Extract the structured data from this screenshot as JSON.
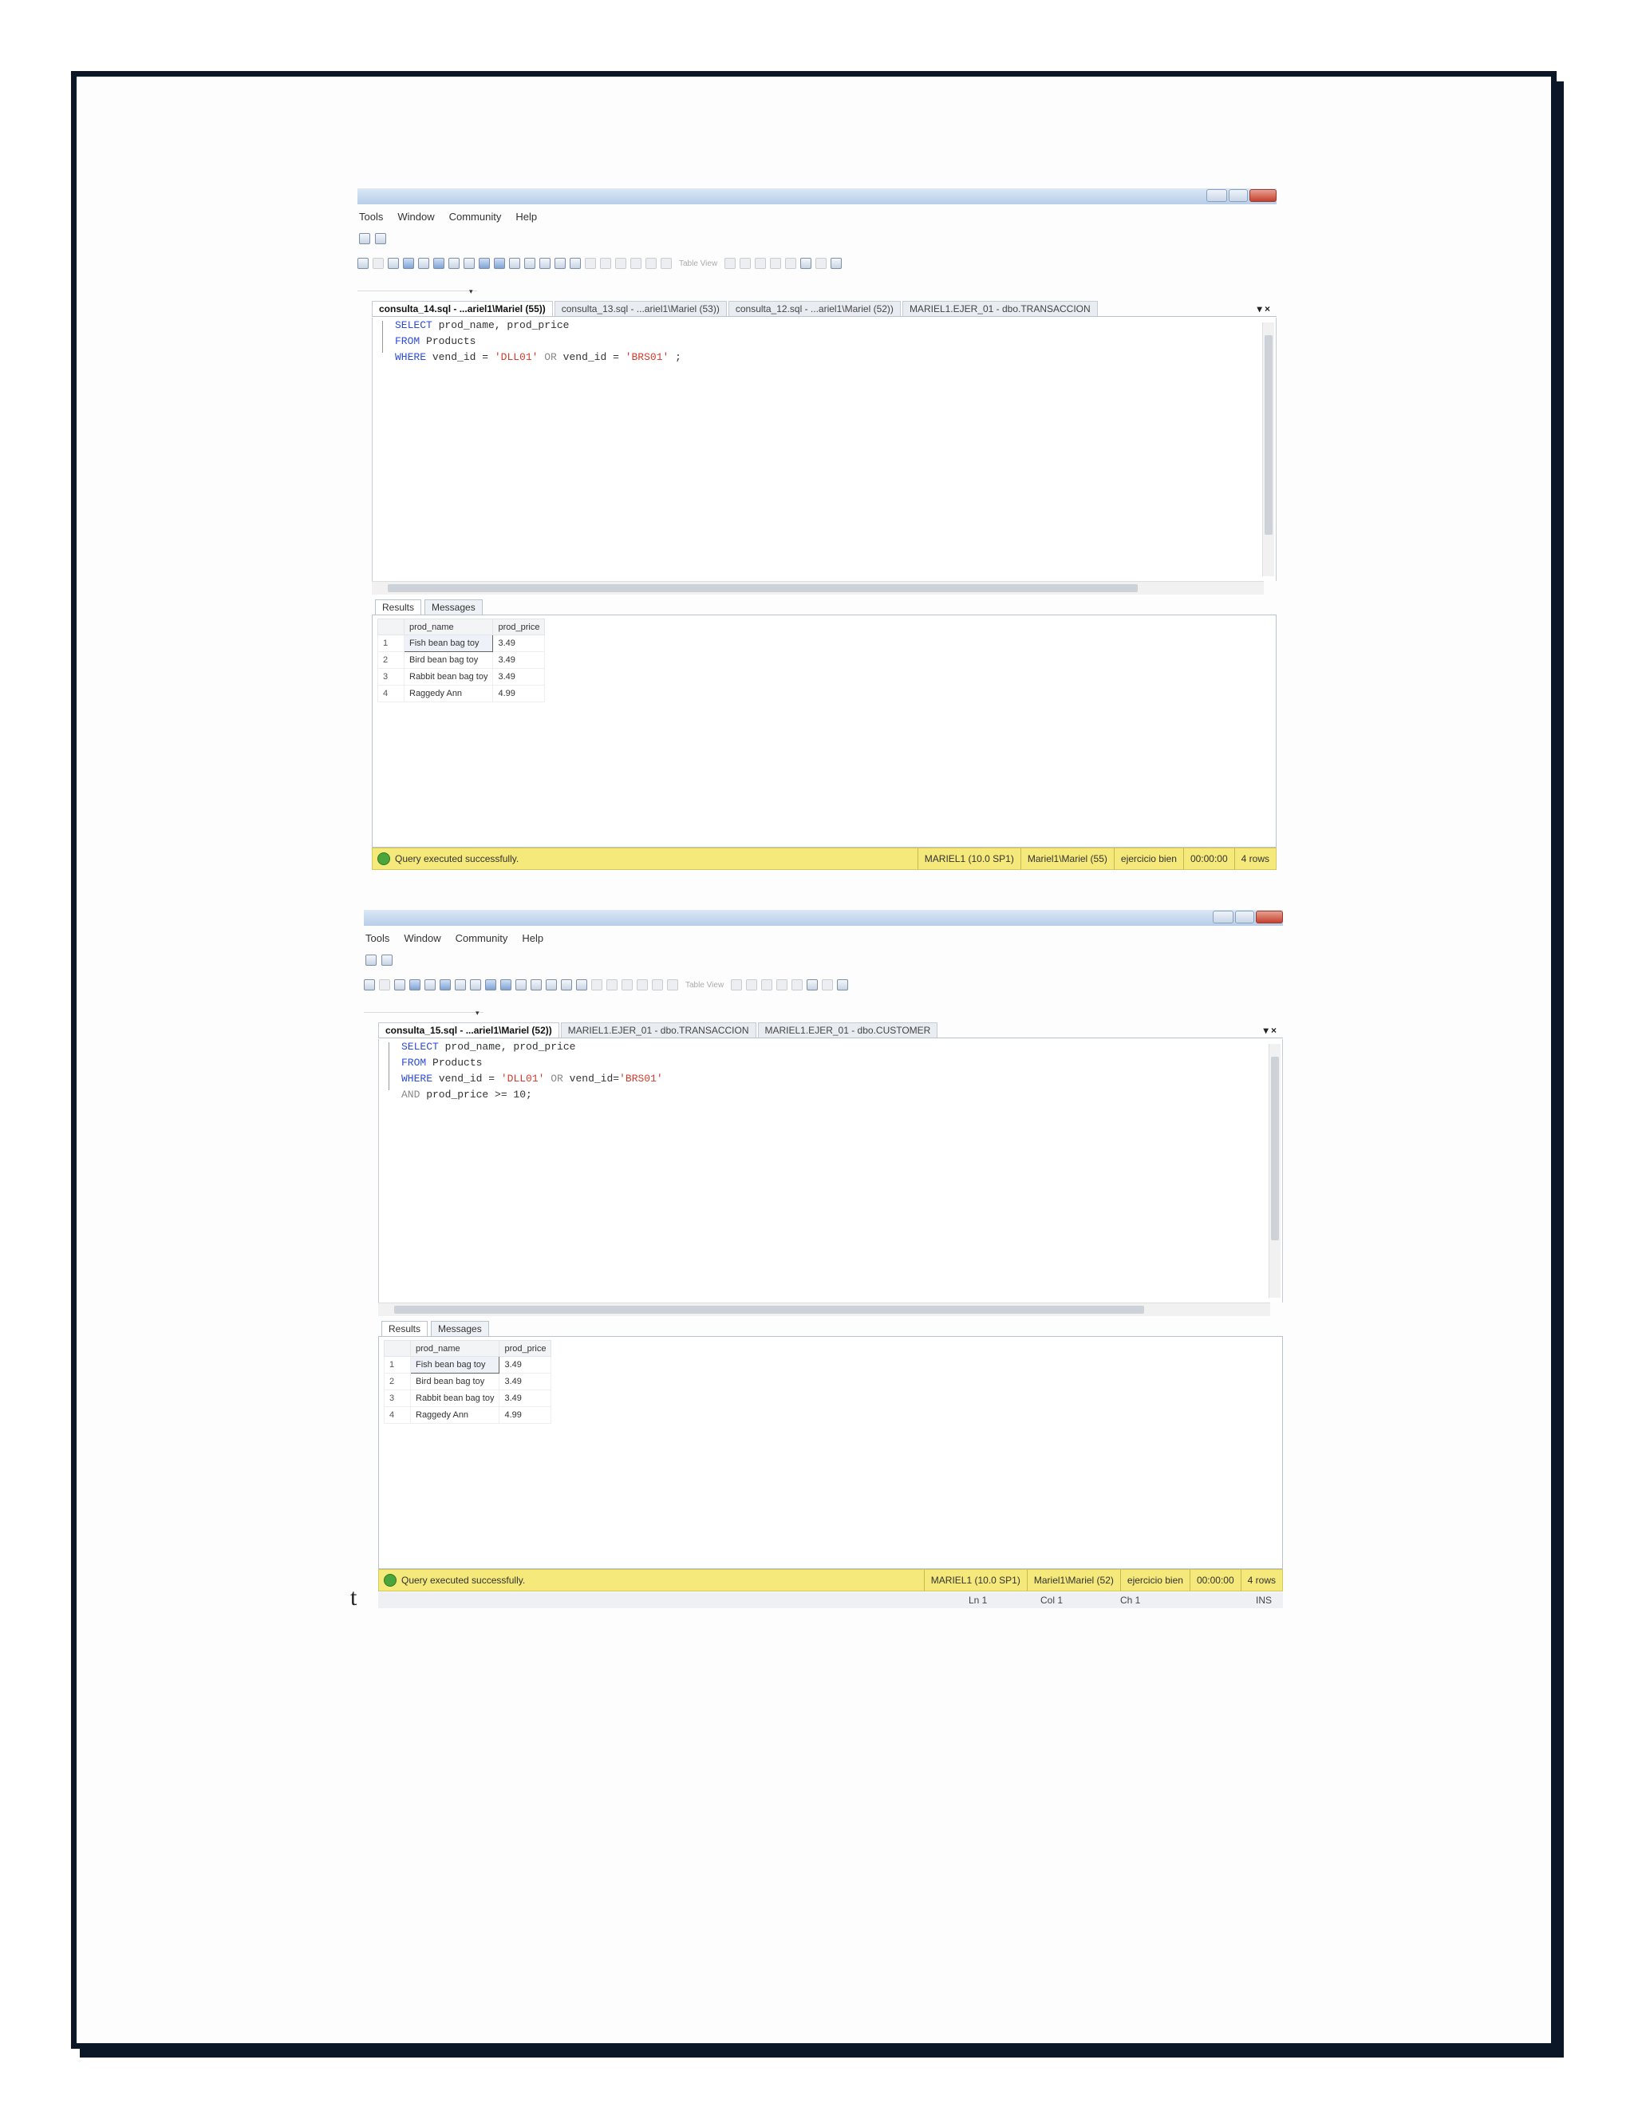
{
  "document": {
    "stray_char": "t"
  },
  "screenshots": [
    {
      "menu": [
        "Tools",
        "Window",
        "Community",
        "Help"
      ],
      "toolbar": {
        "table_view_label": "Table View"
      },
      "tabs": [
        "consulta_14.sql - ...ariel1\\Mariel (55))",
        "consulta_13.sql - ...ariel1\\Mariel (53))",
        "consulta_12.sql - ...ariel1\\Mariel (52))",
        "MARIEL1.EJER_01 - dbo.TRANSACCION"
      ],
      "tab_controls": "▾ ×",
      "code": [
        {
          "k1": "SELECT",
          "t1": " prod_name, prod_price"
        },
        {
          "k1": "FROM",
          "t1": " Products"
        },
        {
          "k1": "WHERE",
          "t1": " vend_id = ",
          "s1": "'DLL01'",
          "g1": " OR ",
          "t2": "vend_id = ",
          "s2": "'BRS01'",
          "t3": " ;"
        }
      ],
      "result_tabs": [
        "Results",
        "Messages"
      ],
      "grid": {
        "columns": [
          "prod_name",
          "prod_price"
        ],
        "rows": [
          [
            "1",
            "Fish bean bag toy",
            "3.49"
          ],
          [
            "2",
            "Bird bean bag toy",
            "3.49"
          ],
          [
            "3",
            "Rabbit bean bag toy",
            "3.49"
          ],
          [
            "4",
            "Raggedy Ann",
            "4.99"
          ]
        ]
      },
      "status": {
        "message": "Query executed successfully.",
        "server": "MARIEL1 (10.0 SP1)",
        "user": "Mariel1\\Mariel (55)",
        "database": "ejercicio bien",
        "time": "00:00:00",
        "rows": "4 rows"
      }
    },
    {
      "menu": [
        "Tools",
        "Window",
        "Community",
        "Help"
      ],
      "toolbar": {
        "table_view_label": "Table View"
      },
      "tabs": [
        "consulta_15.sql - ...ariel1\\Mariel (52))",
        "MARIEL1.EJER_01 - dbo.TRANSACCION",
        "MARIEL1.EJER_01 - dbo.CUSTOMER"
      ],
      "tab_controls": "▾ ×",
      "code": [
        {
          "k1": "SELECT",
          "t1": " prod_name, prod_price"
        },
        {
          "k1": "FROM",
          "t1": " Products"
        },
        {
          "k1": "WHERE",
          "t1": " vend_id = ",
          "s1": "'DLL01'",
          "g1": " OR ",
          "t2": "vend_id=",
          "s2": "'BRS01'",
          "t3": ""
        },
        {
          "k1": "AND",
          "t1": " prod_price >= 10;"
        }
      ],
      "result_tabs": [
        "Results",
        "Messages"
      ],
      "grid": {
        "columns": [
          "prod_name",
          "prod_price"
        ],
        "rows": [
          [
            "1",
            "Fish bean bag toy",
            "3.49"
          ],
          [
            "2",
            "Bird bean bag toy",
            "3.49"
          ],
          [
            "3",
            "Rabbit bean bag toy",
            "3.49"
          ],
          [
            "4",
            "Raggedy Ann",
            "4.99"
          ]
        ]
      },
      "status": {
        "message": "Query executed successfully.",
        "server": "MARIEL1 (10.0 SP1)",
        "user": "Mariel1\\Mariel (52)",
        "database": "ejercicio bien",
        "time": "00:00:00",
        "rows": "4 rows"
      },
      "editor_status": {
        "line": "Ln 1",
        "col": "Col 1",
        "ch": "Ch 1",
        "mode": "INS"
      }
    }
  ]
}
